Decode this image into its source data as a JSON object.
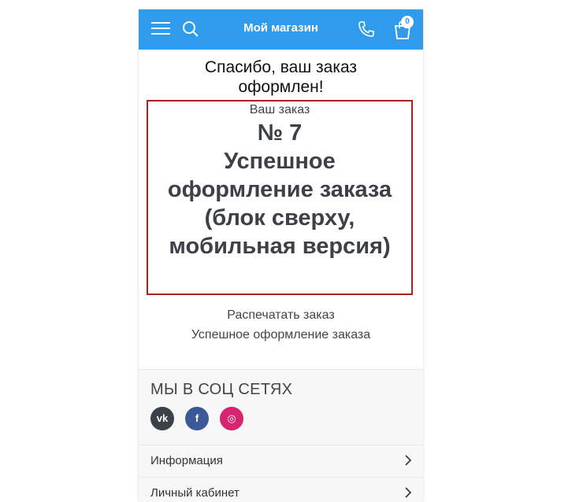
{
  "header": {
    "title": "Мой магазин",
    "cart_count": "0",
    "bg_color": "#2f9bea"
  },
  "confirmation": {
    "thanks": "Спасибо, ваш заказ оформлен!",
    "order_label": "Ваш заказ",
    "order_number": "№ 7",
    "order_name": "Успешное оформление заказа (блок сверху, мобильная версия)"
  },
  "links": {
    "print": "Распечатать заказ",
    "success": "Успешное оформление заказа"
  },
  "footer": {
    "social_title": "МЫ В СОЦ СЕТЯХ",
    "socials": [
      {
        "icon": "vk-icon",
        "glyph": "vk",
        "color": "#3a4149"
      },
      {
        "icon": "facebook-icon",
        "glyph": "f",
        "color": "#3b5998"
      },
      {
        "icon": "instagram-icon",
        "glyph": "◎",
        "color": "#d6246e"
      }
    ],
    "menu": [
      {
        "label": "Информация"
      },
      {
        "label": "Личный кабинет"
      }
    ]
  }
}
